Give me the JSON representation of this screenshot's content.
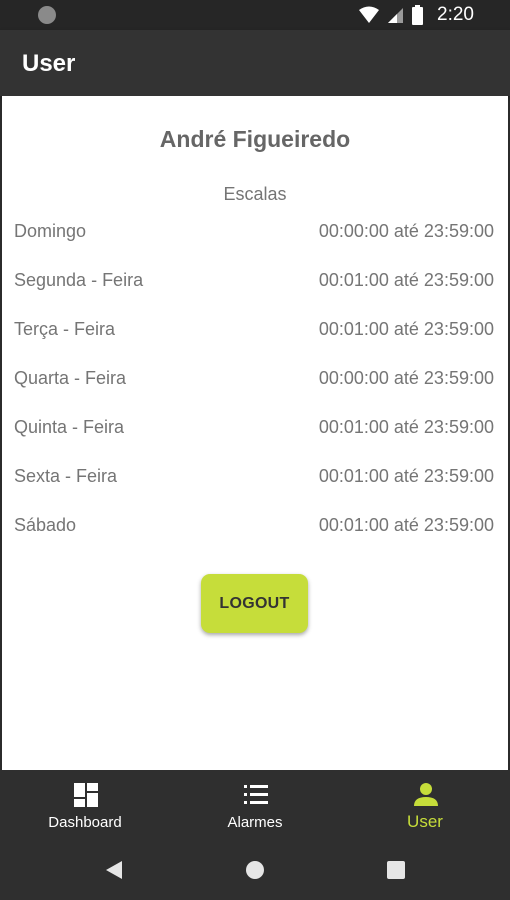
{
  "status_bar": {
    "time": "2:20"
  },
  "app_bar": {
    "title": "User"
  },
  "profile": {
    "name": "André Figueiredo"
  },
  "schedule": {
    "title": "Escalas",
    "rows": [
      {
        "day": "Domingo",
        "hours": "00:00:00 até 23:59:00"
      },
      {
        "day": "Segunda - Feira",
        "hours": "00:01:00 até 23:59:00"
      },
      {
        "day": "Terça - Feira",
        "hours": "00:01:00 até 23:59:00"
      },
      {
        "day": "Quarta - Feira",
        "hours": "00:00:00 até 23:59:00"
      },
      {
        "day": "Quinta - Feira",
        "hours": "00:01:00 até 23:59:00"
      },
      {
        "day": "Sexta - Feira",
        "hours": "00:01:00 até 23:59:00"
      },
      {
        "day": "Sábado",
        "hours": "00:01:00 até 23:59:00"
      }
    ]
  },
  "actions": {
    "logout_label": "LOGOUT"
  },
  "bottom_nav": {
    "items": [
      {
        "label": "Dashboard",
        "icon": "dashboard-icon",
        "active": false
      },
      {
        "label": "Alarmes",
        "icon": "list-icon",
        "active": false
      },
      {
        "label": "User",
        "icon": "person-icon",
        "active": true
      }
    ]
  },
  "colors": {
    "accent": "#c6dd3a",
    "app_bar": "#333333",
    "text_muted": "#757575"
  }
}
